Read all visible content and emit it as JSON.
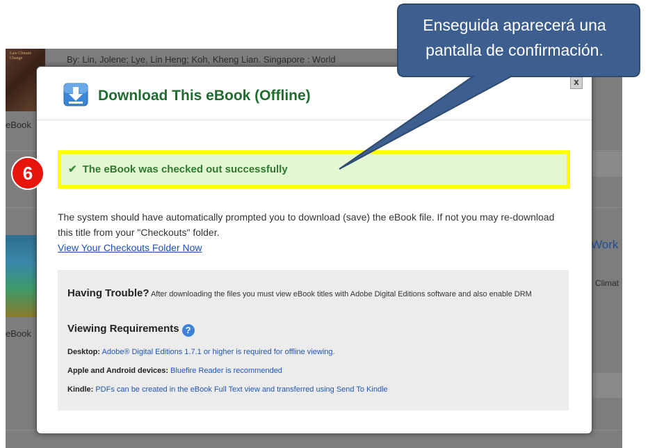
{
  "background": {
    "citation": "By: Lin, Jolene; Lye, Lin Heng; Koh, Kheng Lian. Singapore : World",
    "ebook_label_1": "eBook",
    "ebook_label_2": "eBook",
    "side_word_1": "Work",
    "side_word_2": "Climat"
  },
  "modal": {
    "title": "Download This eBook (Offline)",
    "close_label": "x",
    "success_message": "The eBook was checked out successfully",
    "body_text": "The system should have automatically prompted you to download (save) the eBook file. If not you may re-download this title from your \"Checkouts\" folder.",
    "checkouts_link": "View Your Checkouts Folder Now",
    "trouble": {
      "heading": "Having Trouble?",
      "text": "After downloading the files you must view eBook titles with Adobe Digital Editions software and also enable DRM",
      "requirements_heading": "Viewing Requirements",
      "rows": [
        {
          "label": "Desktop:",
          "value": "Adobe® Digital Editions 1.7.1 or higher is required for offline viewing."
        },
        {
          "label": "Apple and Android devices:",
          "value": "Bluefire Reader is recommended"
        },
        {
          "label": "Kindle:",
          "value": "PDFs can be created in the eBook Full Text view and transferred using Send To Kindle"
        }
      ]
    }
  },
  "annotation": {
    "step_number": "6",
    "callout_text": "Enseguida aparecerá una pantalla de confirmación.",
    "callout_color": "#3c5f8f",
    "highlight_color": "#ffff00",
    "badge_color": "#e8140e"
  }
}
